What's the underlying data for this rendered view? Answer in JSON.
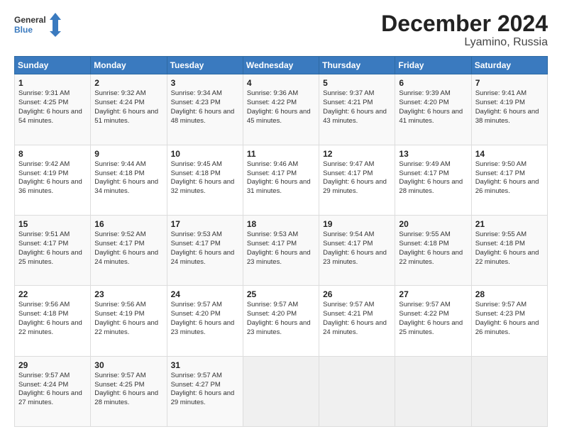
{
  "header": {
    "logo_line1": "General",
    "logo_line2": "Blue",
    "title": "December 2024",
    "subtitle": "Lyamino, Russia"
  },
  "days_of_week": [
    "Sunday",
    "Monday",
    "Tuesday",
    "Wednesday",
    "Thursday",
    "Friday",
    "Saturday"
  ],
  "weeks": [
    [
      {
        "day": 1,
        "sunrise": "9:31 AM",
        "sunset": "4:25 PM",
        "daylight": "6 hours and 54 minutes."
      },
      {
        "day": 2,
        "sunrise": "9:32 AM",
        "sunset": "4:24 PM",
        "daylight": "6 hours and 51 minutes."
      },
      {
        "day": 3,
        "sunrise": "9:34 AM",
        "sunset": "4:23 PM",
        "daylight": "6 hours and 48 minutes."
      },
      {
        "day": 4,
        "sunrise": "9:36 AM",
        "sunset": "4:22 PM",
        "daylight": "6 hours and 45 minutes."
      },
      {
        "day": 5,
        "sunrise": "9:37 AM",
        "sunset": "4:21 PM",
        "daylight": "6 hours and 43 minutes."
      },
      {
        "day": 6,
        "sunrise": "9:39 AM",
        "sunset": "4:20 PM",
        "daylight": "6 hours and 41 minutes."
      },
      {
        "day": 7,
        "sunrise": "9:41 AM",
        "sunset": "4:19 PM",
        "daylight": "6 hours and 38 minutes."
      }
    ],
    [
      {
        "day": 8,
        "sunrise": "9:42 AM",
        "sunset": "4:19 PM",
        "daylight": "6 hours and 36 minutes."
      },
      {
        "day": 9,
        "sunrise": "9:44 AM",
        "sunset": "4:18 PM",
        "daylight": "6 hours and 34 minutes."
      },
      {
        "day": 10,
        "sunrise": "9:45 AM",
        "sunset": "4:18 PM",
        "daylight": "6 hours and 32 minutes."
      },
      {
        "day": 11,
        "sunrise": "9:46 AM",
        "sunset": "4:17 PM",
        "daylight": "6 hours and 31 minutes."
      },
      {
        "day": 12,
        "sunrise": "9:47 AM",
        "sunset": "4:17 PM",
        "daylight": "6 hours and 29 minutes."
      },
      {
        "day": 13,
        "sunrise": "9:49 AM",
        "sunset": "4:17 PM",
        "daylight": "6 hours and 28 minutes."
      },
      {
        "day": 14,
        "sunrise": "9:50 AM",
        "sunset": "4:17 PM",
        "daylight": "6 hours and 26 minutes."
      }
    ],
    [
      {
        "day": 15,
        "sunrise": "9:51 AM",
        "sunset": "4:17 PM",
        "daylight": "6 hours and 25 minutes."
      },
      {
        "day": 16,
        "sunrise": "9:52 AM",
        "sunset": "4:17 PM",
        "daylight": "6 hours and 24 minutes."
      },
      {
        "day": 17,
        "sunrise": "9:53 AM",
        "sunset": "4:17 PM",
        "daylight": "6 hours and 24 minutes."
      },
      {
        "day": 18,
        "sunrise": "9:53 AM",
        "sunset": "4:17 PM",
        "daylight": "6 hours and 23 minutes."
      },
      {
        "day": 19,
        "sunrise": "9:54 AM",
        "sunset": "4:17 PM",
        "daylight": "6 hours and 23 minutes."
      },
      {
        "day": 20,
        "sunrise": "9:55 AM",
        "sunset": "4:18 PM",
        "daylight": "6 hours and 22 minutes."
      },
      {
        "day": 21,
        "sunrise": "9:55 AM",
        "sunset": "4:18 PM",
        "daylight": "6 hours and 22 minutes."
      }
    ],
    [
      {
        "day": 22,
        "sunrise": "9:56 AM",
        "sunset": "4:18 PM",
        "daylight": "6 hours and 22 minutes."
      },
      {
        "day": 23,
        "sunrise": "9:56 AM",
        "sunset": "4:19 PM",
        "daylight": "6 hours and 22 minutes."
      },
      {
        "day": 24,
        "sunrise": "9:57 AM",
        "sunset": "4:20 PM",
        "daylight": "6 hours and 23 minutes."
      },
      {
        "day": 25,
        "sunrise": "9:57 AM",
        "sunset": "4:20 PM",
        "daylight": "6 hours and 23 minutes."
      },
      {
        "day": 26,
        "sunrise": "9:57 AM",
        "sunset": "4:21 PM",
        "daylight": "6 hours and 24 minutes."
      },
      {
        "day": 27,
        "sunrise": "9:57 AM",
        "sunset": "4:22 PM",
        "daylight": "6 hours and 25 minutes."
      },
      {
        "day": 28,
        "sunrise": "9:57 AM",
        "sunset": "4:23 PM",
        "daylight": "6 hours and 26 minutes."
      }
    ],
    [
      {
        "day": 29,
        "sunrise": "9:57 AM",
        "sunset": "4:24 PM",
        "daylight": "6 hours and 27 minutes."
      },
      {
        "day": 30,
        "sunrise": "9:57 AM",
        "sunset": "4:25 PM",
        "daylight": "6 hours and 28 minutes."
      },
      {
        "day": 31,
        "sunrise": "9:57 AM",
        "sunset": "4:27 PM",
        "daylight": "6 hours and 29 minutes."
      },
      null,
      null,
      null,
      null
    ]
  ]
}
